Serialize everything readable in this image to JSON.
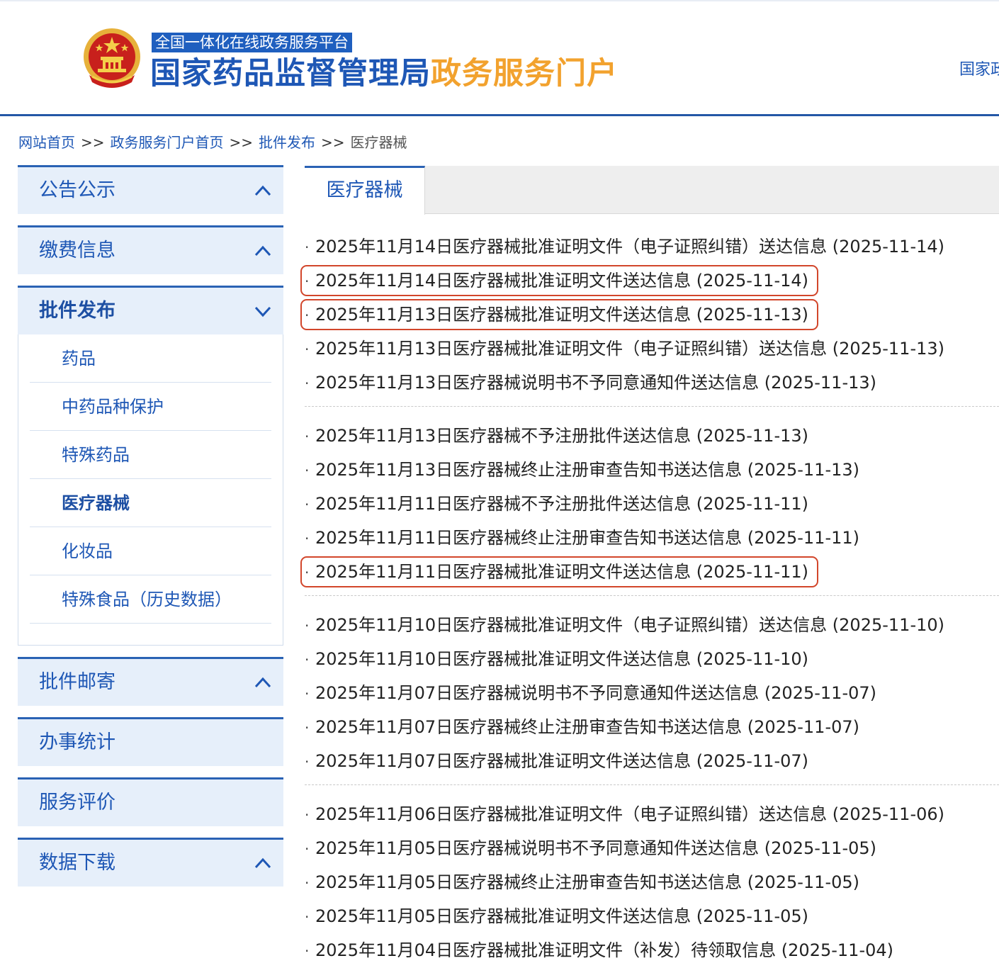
{
  "header": {
    "platform_tag": "全国一体化在线政务服务平台",
    "title_main": "国家药品监督管理局",
    "title_sub": "政务服务门户",
    "right_link": "国家政"
  },
  "breadcrumb": [
    {
      "label": "网站首页"
    },
    {
      "label": "政务服务门户首页"
    },
    {
      "label": "批件发布"
    },
    {
      "label": "医疗器械"
    }
  ],
  "breadcrumb_sep": ">>",
  "sidebar": {
    "groups": [
      {
        "label": "公告公示",
        "chevron": "up"
      },
      {
        "label": "缴费信息",
        "chevron": "up"
      },
      {
        "label": "批件发布",
        "chevron": "down",
        "expanded": true,
        "items": [
          {
            "label": "药品"
          },
          {
            "label": "中药品种保护"
          },
          {
            "label": "特殊药品"
          },
          {
            "label": "医疗器械",
            "current": true
          },
          {
            "label": "化妆品"
          },
          {
            "label": "特殊食品（历史数据）"
          }
        ]
      },
      {
        "label": "批件邮寄",
        "chevron": "up"
      },
      {
        "label": "办事统计",
        "chevron": "none"
      },
      {
        "label": "服务评价",
        "chevron": "none"
      },
      {
        "label": "数据下载",
        "chevron": "up"
      }
    ]
  },
  "content": {
    "tab_label": "医疗器械",
    "bullet": "·",
    "list_groups": [
      [
        {
          "title": "2025年11月14日医疗器械批准证明文件（电子证照纠错）送达信息",
          "date": "(2025-11-14)"
        },
        {
          "title": "2025年11月14日医疗器械批准证明文件送达信息",
          "date": "(2025-11-14)",
          "highlighted": true
        },
        {
          "title": "2025年11月13日医疗器械批准证明文件送达信息",
          "date": "(2025-11-13)",
          "highlighted": true
        },
        {
          "title": "2025年11月13日医疗器械批准证明文件（电子证照纠错）送达信息",
          "date": "(2025-11-13)"
        },
        {
          "title": "2025年11月13日医疗器械说明书不予同意通知件送达信息",
          "date": "(2025-11-13)"
        }
      ],
      [
        {
          "title": "2025年11月13日医疗器械不予注册批件送达信息",
          "date": "(2025-11-13)"
        },
        {
          "title": "2025年11月13日医疗器械终止注册审查告知书送达信息",
          "date": "(2025-11-13)"
        },
        {
          "title": "2025年11月11日医疗器械不予注册批件送达信息",
          "date": "(2025-11-11)"
        },
        {
          "title": "2025年11月11日医疗器械终止注册审查告知书送达信息",
          "date": "(2025-11-11)"
        },
        {
          "title": "2025年11月11日医疗器械批准证明文件送达信息",
          "date": "(2025-11-11)",
          "highlighted": true
        }
      ],
      [
        {
          "title": "2025年11月10日医疗器械批准证明文件（电子证照纠错）送达信息",
          "date": "(2025-11-10)"
        },
        {
          "title": "2025年11月10日医疗器械批准证明文件送达信息",
          "date": "(2025-11-10)"
        },
        {
          "title": "2025年11月07日医疗器械说明书不予同意通知件送达信息",
          "date": "(2025-11-07)"
        },
        {
          "title": "2025年11月07日医疗器械终止注册审查告知书送达信息",
          "date": "(2025-11-07)"
        },
        {
          "title": "2025年11月07日医疗器械批准证明文件送达信息",
          "date": "(2025-11-07)"
        }
      ],
      [
        {
          "title": "2025年11月06日医疗器械批准证明文件（电子证照纠错）送达信息",
          "date": "(2025-11-06)"
        },
        {
          "title": "2025年11月05日医疗器械说明书不予同意通知件送达信息",
          "date": "(2025-11-05)"
        },
        {
          "title": "2025年11月05日医疗器械终止注册审查告知书送达信息",
          "date": "(2025-11-05)"
        },
        {
          "title": "2025年11月05日医疗器械批准证明文件送达信息",
          "date": "(2025-11-05)"
        },
        {
          "title": "2025年11月04日医疗器械批准证明文件（补发）待领取信息",
          "date": "(2025-11-04)"
        }
      ]
    ]
  },
  "colors": {
    "brand_blue": "#1e57b5",
    "title_orange": "#f2a22e",
    "highlight_red": "#d2462b",
    "nav_bg": "#e6effa"
  },
  "icons": {
    "emblem": "national-emblem-icon",
    "chevron_up": "chevron-up-icon",
    "chevron_down": "chevron-down-icon"
  }
}
